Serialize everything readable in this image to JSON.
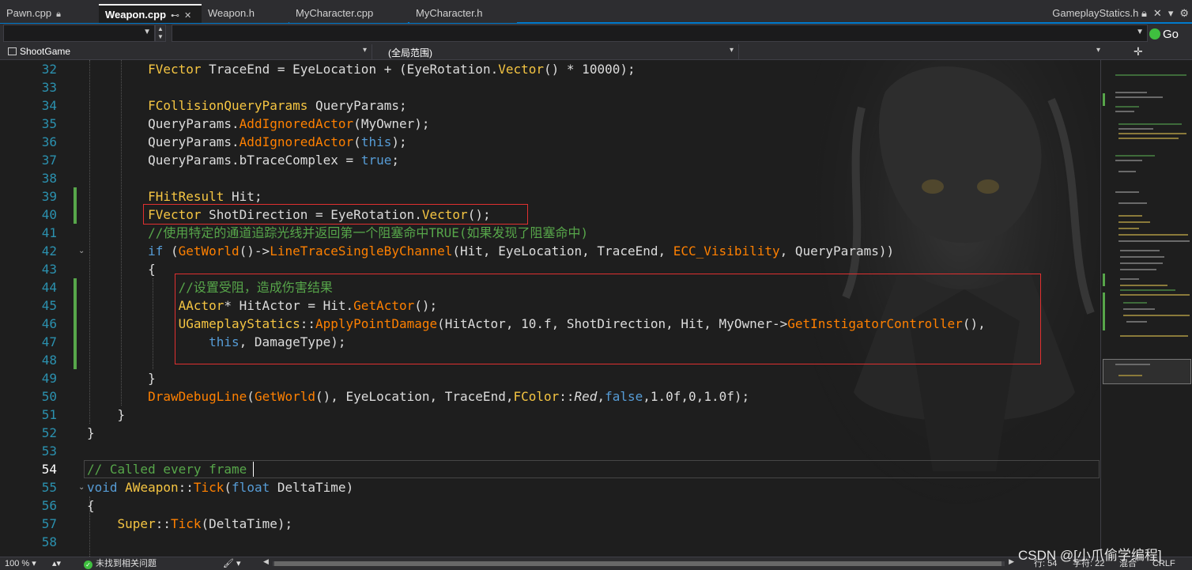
{
  "tabs": [
    {
      "label": "Pawn.cpp",
      "icon": "lock-icon"
    },
    {
      "label": "Weapon.cpp",
      "icon": "pin-icon",
      "active": true
    },
    {
      "label": "Weapon.h"
    },
    {
      "label": "MyCharacter.cpp"
    },
    {
      "label": "MyCharacter.h"
    }
  ],
  "right_tab": {
    "label": "GameplayStatics.h"
  },
  "toolbar": {
    "go_label": "Go"
  },
  "nav": {
    "project": "ShootGame",
    "scope": "(全局范围)",
    "member": ""
  },
  "editor": {
    "lines": [
      {
        "n": "32"
      },
      {
        "n": "33"
      },
      {
        "n": "34"
      },
      {
        "n": "35"
      },
      {
        "n": "36"
      },
      {
        "n": "37"
      },
      {
        "n": "38"
      },
      {
        "n": "39"
      },
      {
        "n": "40"
      },
      {
        "n": "41"
      },
      {
        "n": "42"
      },
      {
        "n": "43"
      },
      {
        "n": "44"
      },
      {
        "n": "45"
      },
      {
        "n": "46"
      },
      {
        "n": "47"
      },
      {
        "n": "48"
      },
      {
        "n": "49"
      },
      {
        "n": "50"
      },
      {
        "n": "51"
      },
      {
        "n": "52"
      },
      {
        "n": "53"
      },
      {
        "n": "54"
      },
      {
        "n": "55"
      },
      {
        "n": "56"
      },
      {
        "n": "57"
      },
      {
        "n": "58"
      }
    ],
    "current_line": "54"
  },
  "status": {
    "zoom": "100 %",
    "issues": "未找到相关问题",
    "line": "行: 54",
    "col": "字符: 22",
    "mode": "混合",
    "eol": "CRLF"
  },
  "watermark": "CSDN @[小爪偷学编程]",
  "colors": {
    "accent": "#007acc",
    "changed": "#57a64a",
    "highlight_box": "#e03030"
  }
}
